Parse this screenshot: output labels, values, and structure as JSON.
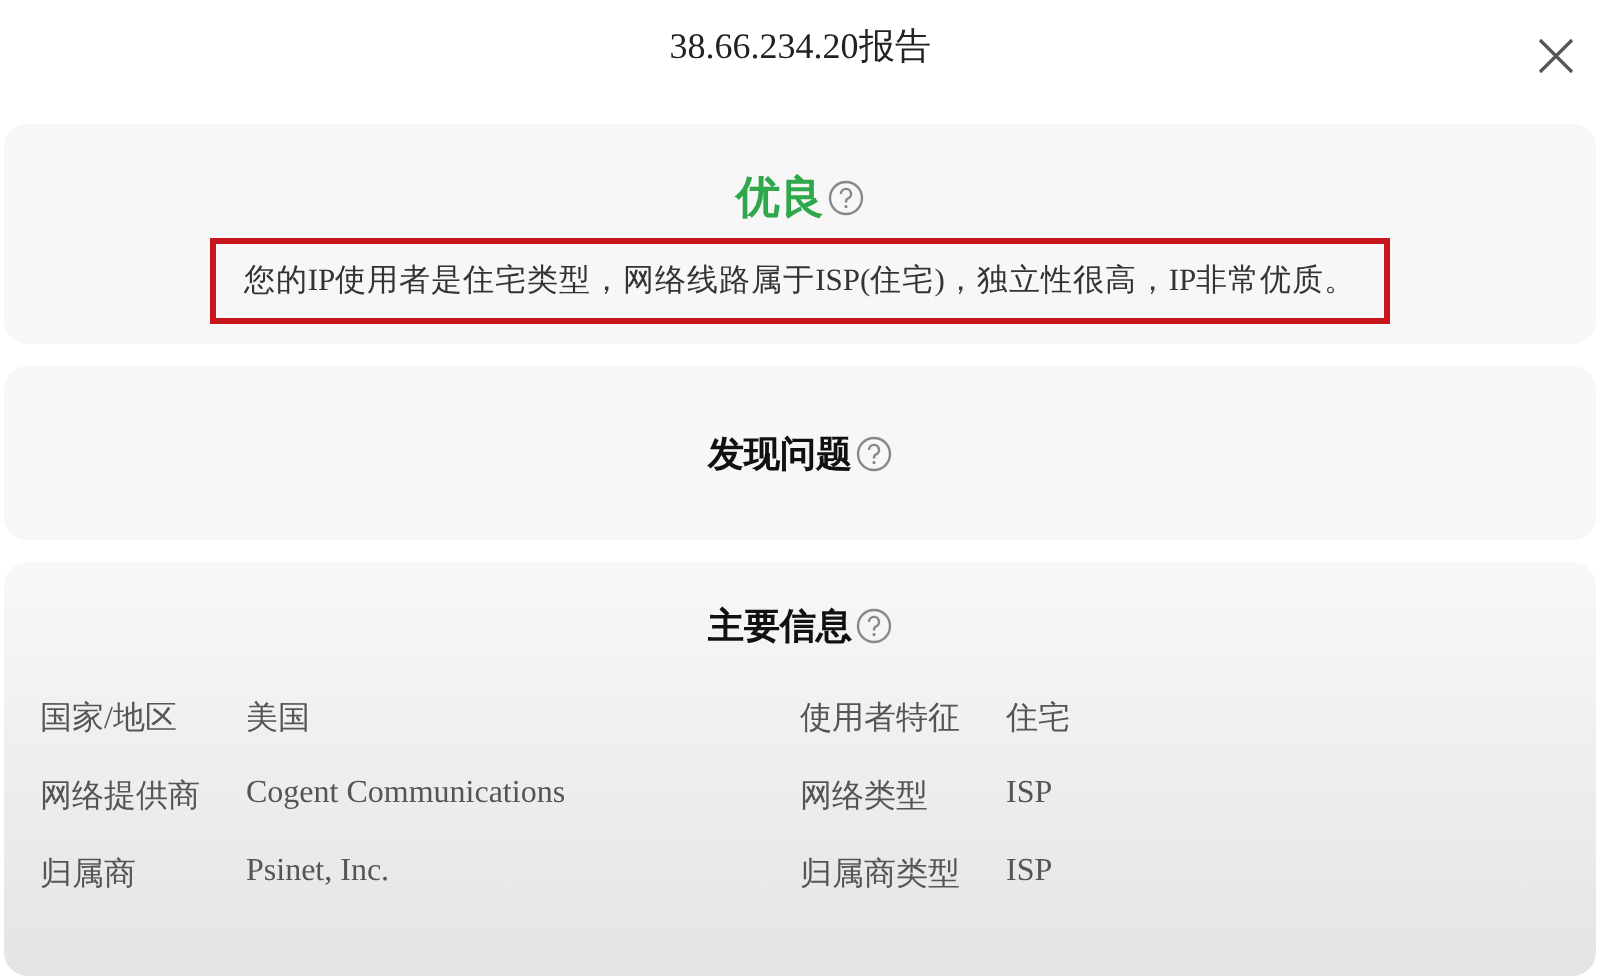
{
  "window": {
    "title": "38.66.234.20报告"
  },
  "rating": {
    "grade": "优良",
    "color": "#2ea84a",
    "summary": "您的IP使用者是住宅类型，网络线路属于ISP(住宅)，独立性很高，IP非常优质。",
    "highlighted": true
  },
  "issues": {
    "title": "发现问题"
  },
  "main_info": {
    "title": "主要信息",
    "fields": [
      {
        "label": "国家/地区",
        "value": "美国"
      },
      {
        "label": "使用者特征",
        "value": "住宅"
      },
      {
        "label": "网络提供商",
        "value": "Cogent Communications"
      },
      {
        "label": "网络类型",
        "value": "ISP"
      },
      {
        "label": "归属商",
        "value": "Psinet, Inc."
      },
      {
        "label": "归属商类型",
        "value": "ISP"
      }
    ]
  }
}
